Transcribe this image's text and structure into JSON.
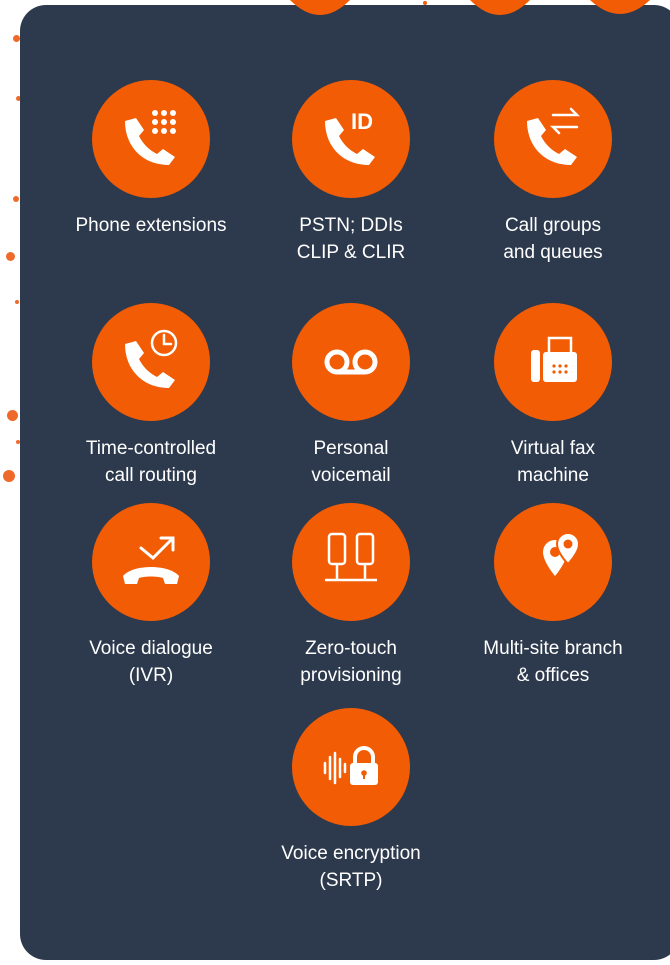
{
  "colors": {
    "panel": "#2d3a4d",
    "accent": "#f25c05",
    "text": "#ffffff"
  },
  "features": [
    {
      "icon": "phone-keypad-icon",
      "label": "Phone extensions"
    },
    {
      "icon": "phone-id-icon",
      "label": "PSTN; DDIs\nCLIP & CLIR"
    },
    {
      "icon": "phone-transfer-icon",
      "label": "Call groups\nand queues"
    },
    {
      "icon": "phone-clock-icon",
      "label": "Time-controlled\ncall routing"
    },
    {
      "icon": "voicemail-icon",
      "label": "Personal\nvoicemail"
    },
    {
      "icon": "fax-machine-icon",
      "label": "Virtual fax\nmachine"
    },
    {
      "icon": "ivr-phone-icon",
      "label": "Voice dialogue\n(IVR)"
    },
    {
      "icon": "devices-provisioning-icon",
      "label": "Zero-touch\nprovisioning"
    },
    {
      "icon": "map-pins-icon",
      "label": "Multi-site branch\n& offices"
    },
    {
      "icon": "encryption-lock-icon",
      "label": "Voice encryption\n(SRTP)"
    }
  ]
}
